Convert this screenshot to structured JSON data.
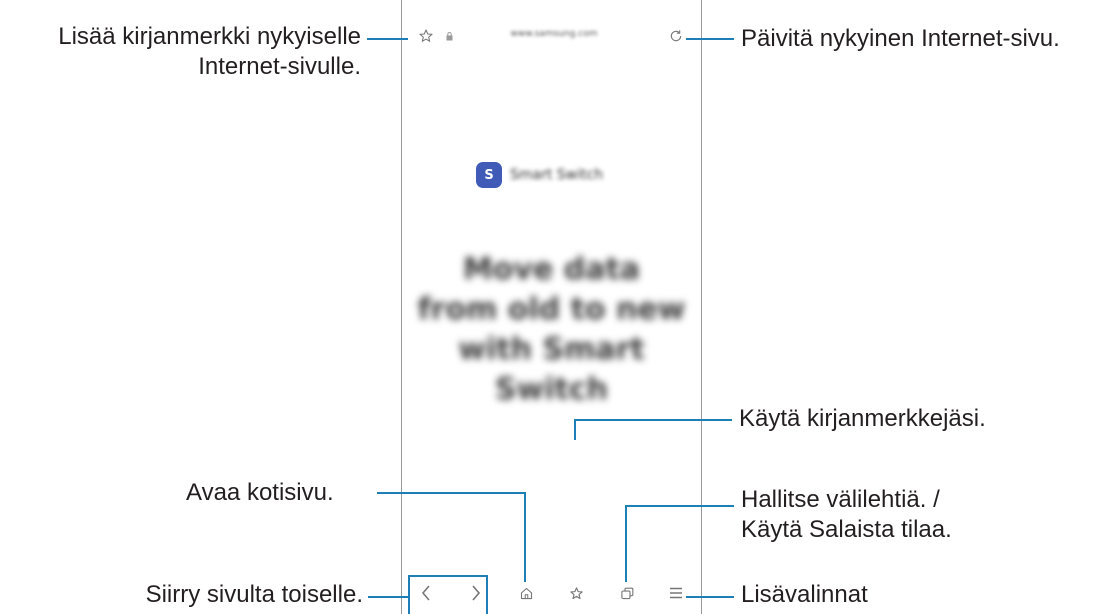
{
  "browser": {
    "url": "www.samsung.com",
    "site_name": "Smart Switch",
    "headline": [
      "Move data",
      "from old to new",
      "with Smart Switch"
    ]
  },
  "callouts": {
    "bookmark_line1": "Lisää kirjanmerkki nykyiselle",
    "bookmark_line2": "Internet-sivulle.",
    "refresh": "Päivitä nykyinen Internet-sivu.",
    "bookmarks": "Käytä kirjanmerkkejäsi.",
    "home": "Avaa kotisivu.",
    "tabs_line1": "Hallitse välilehtiä. /",
    "tabs_line2": "Käytä Salaista tilaa.",
    "navigate": "Siirry sivulta toiselle.",
    "more": "Lisävalinnat"
  },
  "icons": {
    "bookmark_add": "star-outline-icon",
    "lock": "lock-icon",
    "refresh": "refresh-icon",
    "back": "chevron-left-icon",
    "forward": "chevron-right-icon",
    "home": "home-icon",
    "bookmarks": "star-outline-icon",
    "tabs": "tabs-icon",
    "menu": "menu-icon"
  },
  "colors": {
    "leader_line": "#1e7fb7",
    "logo": "#3f5bb7"
  }
}
